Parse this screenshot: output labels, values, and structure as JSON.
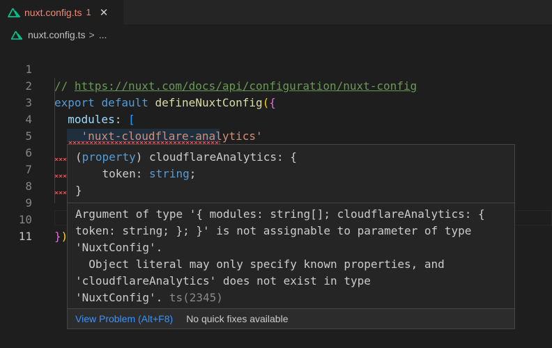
{
  "tab": {
    "title": "nuxt.config.ts",
    "problem_count": "1",
    "close": "✕",
    "icon": "nuxt-icon"
  },
  "breadcrumb": {
    "file": "nuxt.config.ts",
    "separator": ">",
    "more": "..."
  },
  "editor": {
    "line_numbers": [
      "1",
      "2",
      "3",
      "4",
      "5",
      "6",
      "7",
      "8",
      "9",
      "10",
      "11"
    ],
    "line1": {
      "comment": "// ",
      "url": "https://nuxt.com/docs/api/configuration/nuxt-config"
    },
    "line2": {
      "export": "export",
      "default": "default",
      "fn": "defineNuxtConfig",
      "paren": "(",
      "brace": "{"
    },
    "line3": {
      "prop": "modules",
      "colon": ": ",
      "bracket": "["
    },
    "line4": {
      "str": "'nuxt-cloudflare-analytics'"
    },
    "line5": {
      "bracket": "]",
      "comma": ","
    },
    "line6": {
      "prop": "cloudflareAnalytics",
      "colon": ": ",
      "brace": "{"
    },
    "line10": {
      "brace": "}",
      "paren": ")"
    }
  },
  "hover": {
    "signature": {
      "open": "(",
      "kind": "property",
      "close": ")",
      "name": " cloudflareAnalytics: {",
      "token_label": "    token: ",
      "token_type": "string",
      "token_end": ";",
      "end": "}"
    },
    "message_lines": [
      "Argument of type '{ modules: string[]; cloudflareAnalytics: {",
      "token: string; }; }' is not assignable to parameter of type",
      "'NuxtConfig'.",
      "  Object literal may only specify known properties, and",
      "'cloudflareAnalytics' does not exist in type",
      "'NuxtConfig'."
    ],
    "error_code": " ts(2345)",
    "view_problem": "View Problem (Alt+F8)",
    "no_fixes": "No quick fixes available"
  },
  "colors": {
    "error": "#f48771",
    "link": "#3794ff",
    "keyword": "#569cd6",
    "function": "#dcdcaa",
    "property": "#9cdcfe",
    "string": "#ce9178",
    "comment": "#6a9955"
  }
}
